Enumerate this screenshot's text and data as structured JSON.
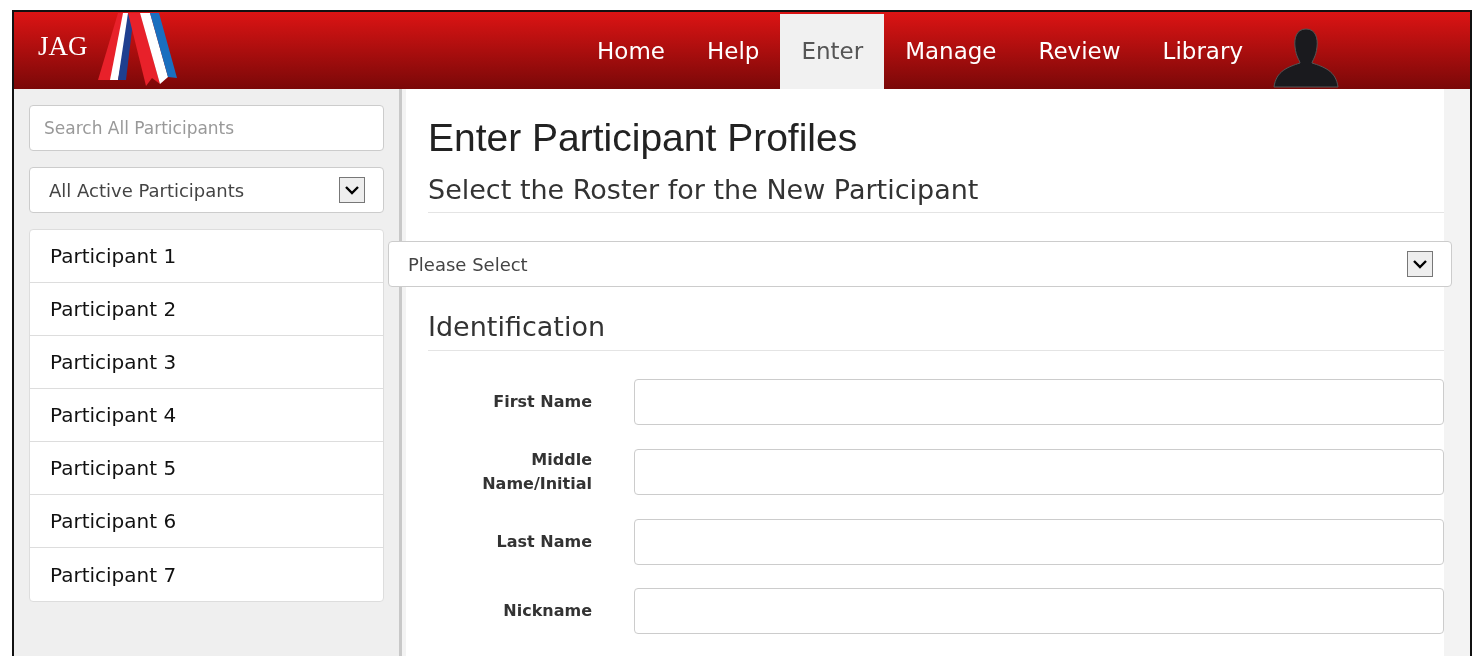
{
  "brand": {
    "name": "JAG"
  },
  "nav": [
    {
      "label": "Home",
      "selected": false
    },
    {
      "label": "Help",
      "selected": false
    },
    {
      "label": "Enter",
      "selected": true
    },
    {
      "label": "Manage",
      "selected": false
    },
    {
      "label": "Review",
      "selected": false
    },
    {
      "label": "Library",
      "selected": false
    }
  ],
  "sidebar": {
    "search": {
      "placeholder": "Search All Participants"
    },
    "filter": {
      "value": "All Active Participants"
    },
    "participants": [
      "Participant 1",
      "Participant 2",
      "Participant 3",
      "Participant 4",
      "Participant 5",
      "Participant 6",
      "Participant 7"
    ]
  },
  "main": {
    "title": "Enter Participant Profiles",
    "roster_heading": "Select the Roster for the New Participant",
    "roster_select": {
      "value": "Please Select"
    },
    "section_heading": "Identification",
    "fields": [
      {
        "label": "First Name"
      },
      {
        "label": "Middle Name/Initial"
      },
      {
        "label": "Last Name"
      },
      {
        "label": "Nickname"
      }
    ]
  }
}
